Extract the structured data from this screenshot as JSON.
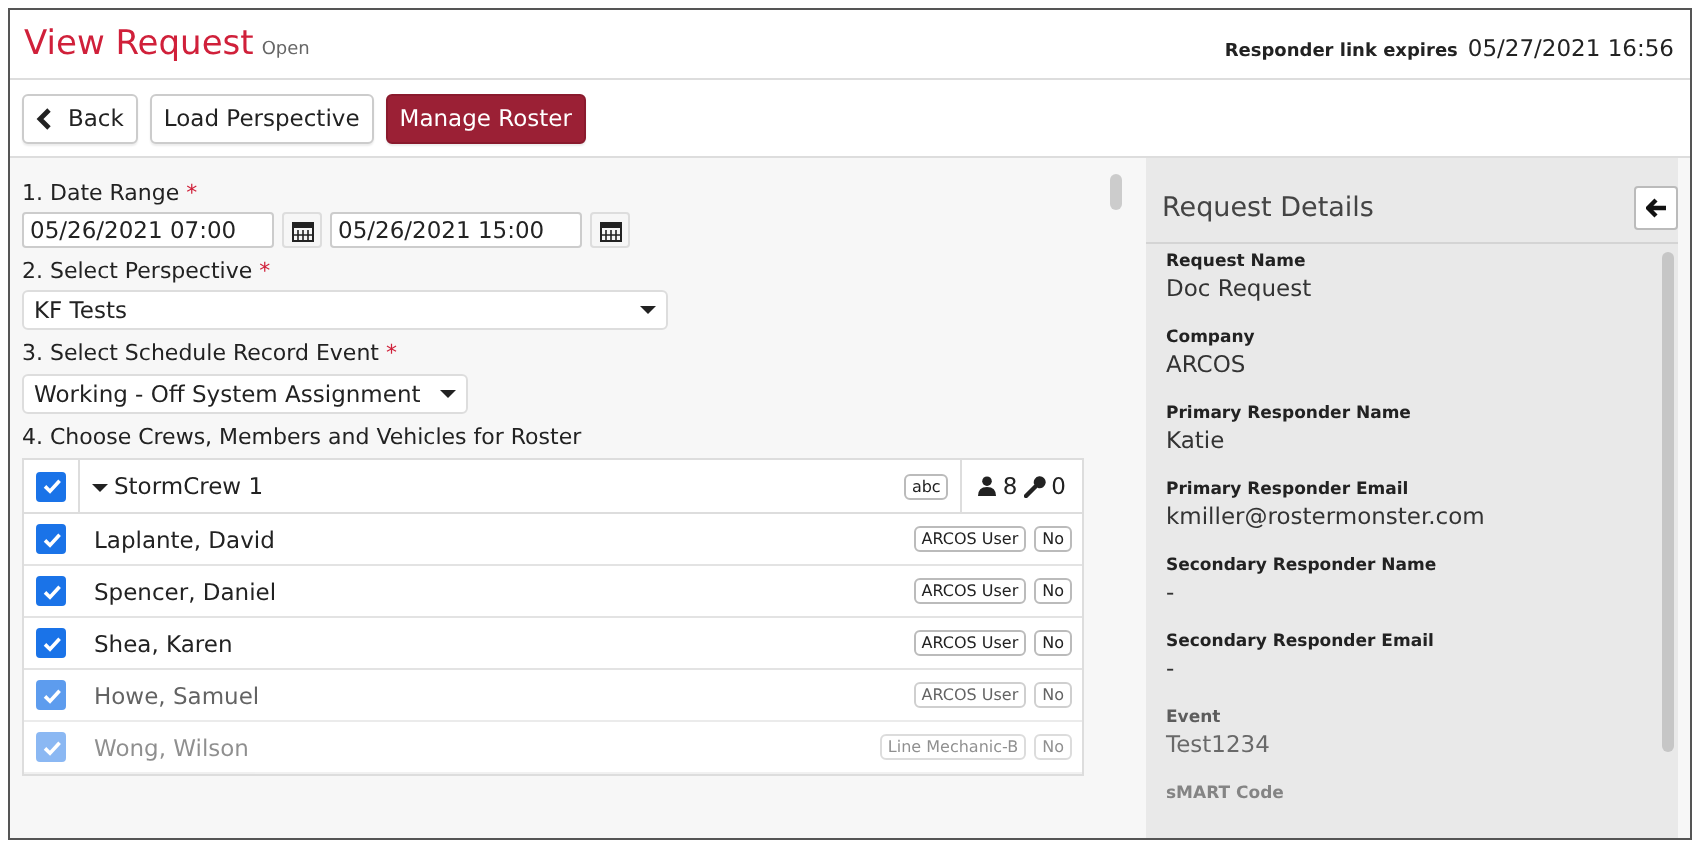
{
  "header": {
    "title": "View Request",
    "status": "Open",
    "expiry_label": "Responder link expires",
    "expiry_value": "05/27/2021 16:56"
  },
  "toolbar": [
    {
      "kind": "back",
      "label": "Back"
    },
    {
      "kind": "plain",
      "label": "Load Perspective"
    },
    {
      "kind": "primary",
      "label": "Manage Roster"
    }
  ],
  "form": {
    "date_range": {
      "label": "1. Date Range",
      "required": "*",
      "start": "05/26/2021 07:00",
      "end": "05/26/2021 15:00"
    },
    "perspective": {
      "label": "2. Select Perspective",
      "required": "*",
      "value": "KF Tests"
    },
    "event": {
      "label": "3. Select Schedule Record Event",
      "required": "*",
      "value": "Working - Off System Assignment"
    },
    "roster_label": "4. Choose Crews, Members and Vehicles for Roster"
  },
  "crew": {
    "checked": true,
    "name": "StormCrew 1",
    "tag": "abc",
    "members_count": "8",
    "vehicles_count": "0"
  },
  "members": [
    {
      "name": "Laplante, David",
      "checked": true,
      "role": "ARCOS User",
      "flag": "No"
    },
    {
      "name": "Spencer, Daniel",
      "checked": true,
      "role": "ARCOS User",
      "flag": "No"
    },
    {
      "name": "Shea, Karen",
      "checked": true,
      "role": "ARCOS User",
      "flag": "No"
    },
    {
      "name": "Howe, Samuel",
      "checked": true,
      "role": "ARCOS User",
      "flag": "No"
    },
    {
      "name": "Wong, Wilson",
      "checked": true,
      "role": "Line Mechanic-B",
      "flag": "No"
    }
  ],
  "details": {
    "title": "Request Details",
    "fields": [
      {
        "label": "Request Name",
        "value": "Doc Request"
      },
      {
        "label": "Company",
        "value": "ARCOS"
      },
      {
        "label": "Primary Responder Name",
        "value": "Katie"
      },
      {
        "label": "Primary Responder Email",
        "value": "kmiller@rostermonster.com"
      },
      {
        "label": "Secondary Responder Name",
        "value": "-"
      },
      {
        "label": "Secondary Responder Email",
        "value": "-"
      },
      {
        "label": "Event",
        "value": "Test1234"
      },
      {
        "label": "sMART Code"
      }
    ]
  }
}
